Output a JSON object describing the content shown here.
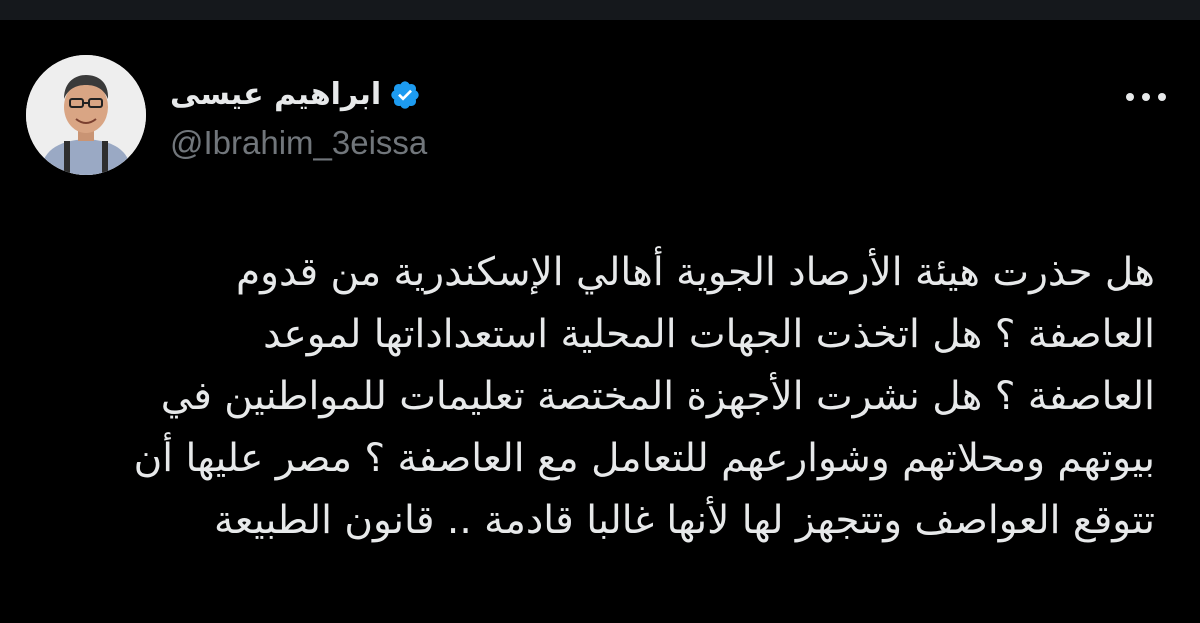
{
  "author": {
    "display_name": "ابراهيم عيسى",
    "handle": "@Ibrahim_3eissa",
    "verified": true,
    "verified_color": "#1d9bf0",
    "avatar_icon": "avatar-photo"
  },
  "tweet": {
    "lines": [
      "هل حذرت هيئة الأرصاد الجوية أهالي الإسكندرية من قدوم",
      "العاصفة ؟ هل اتخذت الجهات المحلية استعداداتها لموعد",
      "العاصفة  ؟ هل نشرت الأجهزة المختصة تعليمات للمواطنين في",
      "بيوتهم ومحلاتهم وشوارعهم للتعامل مع العاصفة ؟ مصر عليها أن",
      "تتوقع العواصف وتتجهز لها لأنها غالبا قادمة .. قانون الطبيعة"
    ]
  },
  "actions": {
    "more_icon": "more-dots-icon"
  },
  "colors": {
    "background": "#000000",
    "text": "#e7e9ea",
    "secondary_text": "#71767b"
  }
}
